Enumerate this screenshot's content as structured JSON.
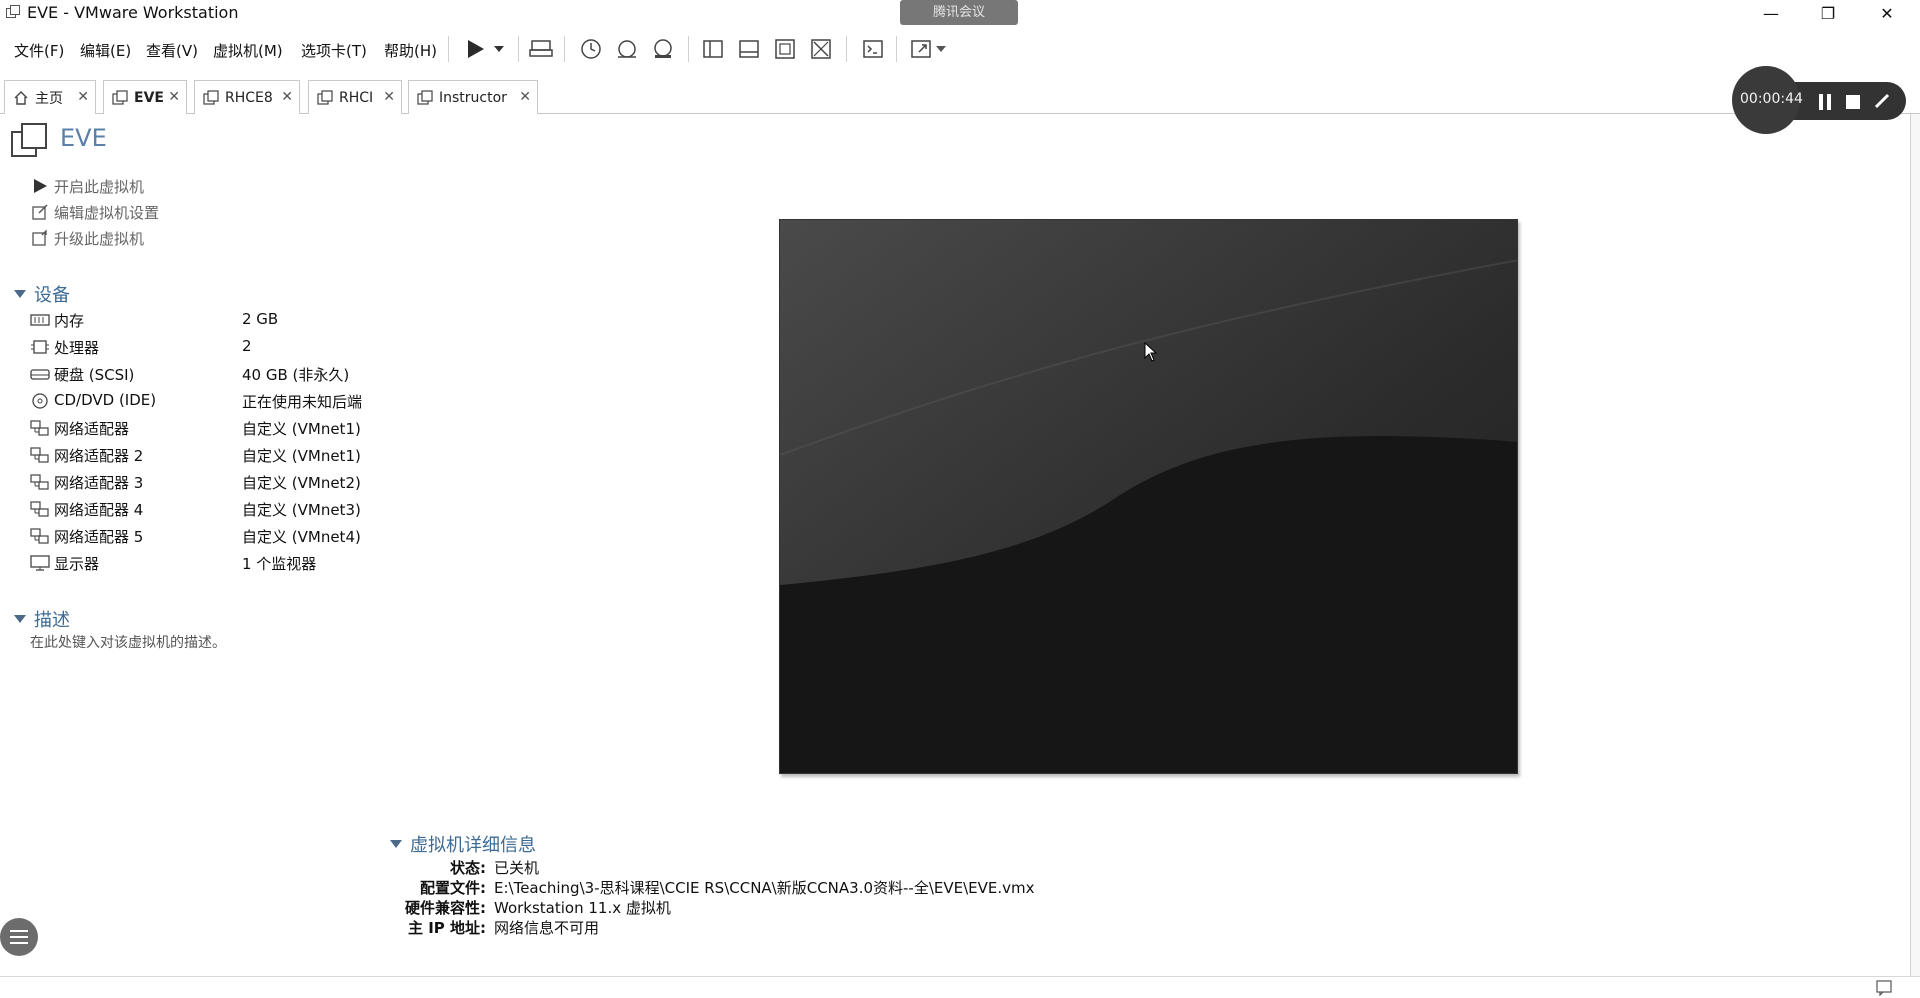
{
  "window": {
    "title": "EVE - VMware Workstation",
    "meeting_badge": "腾讯会议",
    "minimize": "—",
    "restore": "❐",
    "close": "✕"
  },
  "menu": [
    "文件(F)",
    "编辑(E)",
    "查看(V)",
    "虚拟机(M)",
    "选项卡(T)",
    "帮助(H)"
  ],
  "tabs": [
    {
      "label": "主页",
      "icon": "home-icon"
    },
    {
      "label": "EVE",
      "icon": "vm-icon",
      "active": true
    },
    {
      "label": "RHCE8",
      "icon": "vm-icon"
    },
    {
      "label": "RHCI",
      "icon": "vm-icon"
    },
    {
      "label": "Instructor",
      "icon": "vm-icon"
    }
  ],
  "vm": {
    "name": "EVE",
    "actions": [
      "开启此虚拟机",
      "编辑虚拟机设置",
      "升级此虚拟机"
    ]
  },
  "devices": {
    "heading": "设备",
    "items": [
      {
        "name": "内存",
        "value": "2 GB",
        "icon": "memory-icon"
      },
      {
        "name": "处理器",
        "value": "2",
        "icon": "cpu-icon"
      },
      {
        "name": "硬盘 (SCSI)",
        "value": "40 GB (非永久)",
        "icon": "disk-icon"
      },
      {
        "name": "CD/DVD (IDE)",
        "value": "正在使用未知后端",
        "icon": "cd-icon"
      },
      {
        "name": "网络适配器",
        "value": "自定义 (VMnet1)",
        "icon": "network-icon"
      },
      {
        "name": "网络适配器 2",
        "value": "自定义 (VMnet1)",
        "icon": "network-icon"
      },
      {
        "name": "网络适配器 3",
        "value": "自定义 (VMnet2)",
        "icon": "network-icon"
      },
      {
        "name": "网络适配器 4",
        "value": "自定义 (VMnet3)",
        "icon": "network-icon"
      },
      {
        "name": "网络适配器 5",
        "value": "自定义 (VMnet4)",
        "icon": "network-icon"
      },
      {
        "name": "显示器",
        "value": "1 个监视器",
        "icon": "monitor-icon"
      }
    ]
  },
  "description": {
    "heading": "描述",
    "placeholder": "在此处键入对该虚拟机的描述。"
  },
  "details": {
    "heading": "虚拟机详细信息",
    "rows": [
      {
        "label": "状态:",
        "value": "已关机"
      },
      {
        "label": "配置文件:",
        "value": "E:\\Teaching\\3-思科课程\\CCIE RS\\CCNA\\新版CCNA3.0资料--全\\EVE\\EVE.vmx"
      },
      {
        "label": "硬件兼容性:",
        "value": "Workstation 11.x 虚拟机"
      },
      {
        "label": "主 IP 地址:",
        "value": "网络信息不可用"
      }
    ]
  },
  "recorder": {
    "time": "00:00:44"
  },
  "colors": {
    "accent": "#3d6b96",
    "preview_bg": "#1b1b1b"
  }
}
